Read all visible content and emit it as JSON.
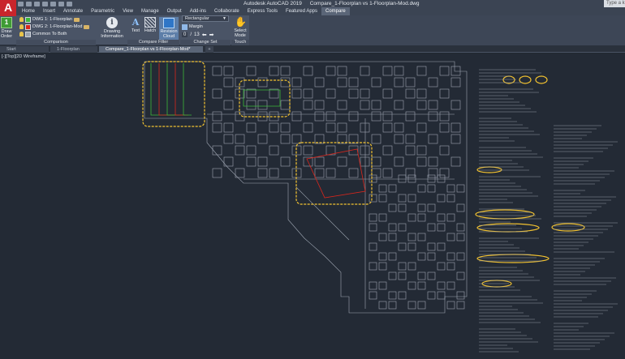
{
  "app": {
    "logo": "A",
    "title": "Autodesk AutoCAD 2019",
    "file": "Compare_1-Floorplan vs 1-Floorplan-Mod.dwg",
    "search_placeholder": "Type a k"
  },
  "menu_tabs": [
    "Home",
    "Insert",
    "Annotate",
    "Parametric",
    "View",
    "Manage",
    "Output",
    "Add-ins",
    "Collaborate",
    "Express Tools",
    "Featured Apps",
    "Compare"
  ],
  "ribbon": {
    "draw_order": {
      "label_line1": "Draw",
      "label_line2": "Order",
      "badge": "1"
    },
    "comparison": {
      "dwg1": "DWG 1: 1-Floorplan",
      "dwg2": "DWG 2: 1-Floorplan-Mod",
      "common": "Common To Both",
      "group_label": "Comparison",
      "dwg1_color": "#3cb83a",
      "dwg2_color": "#d9261c",
      "common_color": "#9aa3ae"
    },
    "drawing_information": {
      "line1": "Drawing",
      "line2": "Information"
    },
    "compare_filter": {
      "text_label": "Text",
      "hatch_label": "Hatch",
      "revcloud_line1": "Revision",
      "revcloud_line2": "Cloud",
      "group_label": "Compare Filter"
    },
    "change_set": {
      "shape": "Rectangular",
      "margin_label": "Margin",
      "current": "0",
      "separator": "/",
      "total": "13",
      "group_label": "Change Set"
    },
    "touch": {
      "select_line1": "Select",
      "select_line2": "Mode",
      "group_label": "Touch"
    }
  },
  "doc_tabs": {
    "start": "Start",
    "tab1": "1-Floorplan",
    "tab2": "Compare_1-Floorplan vs 1-Floorplan-Mod*",
    "plus": "+"
  },
  "viewport": {
    "label": "[-][Top][2D Wireframe]"
  },
  "colors": {
    "ribbon_bg": "#4a5466",
    "canvas_bg": "#232a35",
    "linework": "#9ea6b2",
    "revision_cloud": "#f2c230",
    "added": "#3cb83a",
    "removed": "#d9261c"
  }
}
